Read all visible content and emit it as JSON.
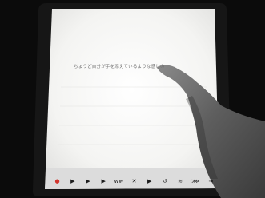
{
  "screen": {
    "text": "ちょうど自分が手を添えているような感じの"
  },
  "toolbar": {
    "labels": [
      "",
      "",
      "",
      "",
      "",
      "",
      "",
      "",
      "",
      "",
      "",
      ""
    ],
    "buttons": [
      {
        "icon": "record-icon",
        "glyph": "●"
      },
      {
        "icon": "play-icon",
        "glyph": "▶"
      },
      {
        "icon": "play-icon",
        "glyph": "▶"
      },
      {
        "icon": "step-forward-icon",
        "glyph": "▶"
      },
      {
        "icon": "waveform-icon",
        "glyph": "ᴡᴡ"
      },
      {
        "icon": "close-icon",
        "glyph": "✕"
      },
      {
        "icon": "play-icon",
        "glyph": "▶"
      },
      {
        "icon": "undo-icon",
        "glyph": "↺"
      },
      {
        "icon": "wave-settings-icon",
        "glyph": "≋"
      },
      {
        "icon": "signal-icon",
        "glyph": "⋙"
      },
      {
        "icon": "exit-icon",
        "glyph": "⇥"
      }
    ]
  },
  "colors": {
    "background": "#0b0b0b",
    "bezel": "#1a1a1a",
    "screen": "#f3f3f1",
    "record": "#d2352d"
  }
}
